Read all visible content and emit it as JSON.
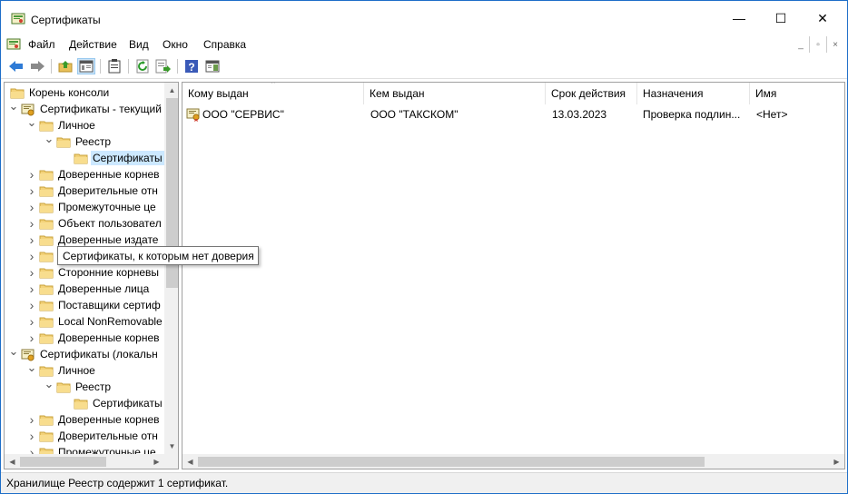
{
  "window": {
    "title": "Сертификаты",
    "min_glyph": "—",
    "max_glyph": "☐",
    "close_glyph": "✕"
  },
  "menu": {
    "items": [
      "Файл",
      "Действие",
      "Вид",
      "Окно",
      "Справка"
    ],
    "mdi": [
      "_",
      "▫",
      "×"
    ]
  },
  "toolbar": {
    "buttons": [
      "back-arrow-icon",
      "forward-arrow-icon",
      "up-folder-icon",
      "show-hide-tree-icon",
      "clipboard-icon",
      "refresh-icon",
      "export-list-icon",
      "help-icon",
      "properties-pane-icon"
    ]
  },
  "tree": {
    "items": [
      {
        "label": "Корень консоли"
      },
      {
        "label": "Сертификаты - текущий"
      },
      {
        "label": "Личное"
      },
      {
        "label": "Реестр"
      },
      {
        "label": "Сертификаты"
      },
      {
        "label": "Доверенные корнев"
      },
      {
        "label": "Доверительные отн"
      },
      {
        "label": "Промежуточные це"
      },
      {
        "label": "Объект пользовател"
      },
      {
        "label": "Доверенные издате"
      },
      {
        "label": "Сертификаты, к кот"
      },
      {
        "label": "Сторонние корневы"
      },
      {
        "label": "Доверенные лица"
      },
      {
        "label": "Поставщики сертиф"
      },
      {
        "label": "Local NonRemovable"
      },
      {
        "label": "Доверенные корнев"
      },
      {
        "label": "Сертификаты (локальн"
      },
      {
        "label": "Личное"
      },
      {
        "label": "Реестр"
      },
      {
        "label": "Сертификаты"
      },
      {
        "label": "Доверенные корнев"
      },
      {
        "label": "Доверительные отн"
      },
      {
        "label": "Промежуточные це"
      }
    ]
  },
  "list": {
    "columns": [
      "Кому выдан",
      "Кем выдан",
      "Срок действия",
      "Назначения",
      "Имя"
    ],
    "rows": [
      {
        "issued_to": "ООО \"СЕРВИС\"",
        "issued_by": "ООО \"ТАКСКОМ\"",
        "expires": "13.03.2023",
        "purposes": "Проверка подлин...",
        "name": "<Нет>"
      }
    ]
  },
  "tooltip": {
    "text": "Сертификаты, к которым нет доверия"
  },
  "status": {
    "text": "Хранилище Реестр содержит 1 сертификат."
  },
  "colors": {
    "accent": "#1e6ec8",
    "selection": "#cce8ff",
    "folder": "#e8c15a"
  }
}
